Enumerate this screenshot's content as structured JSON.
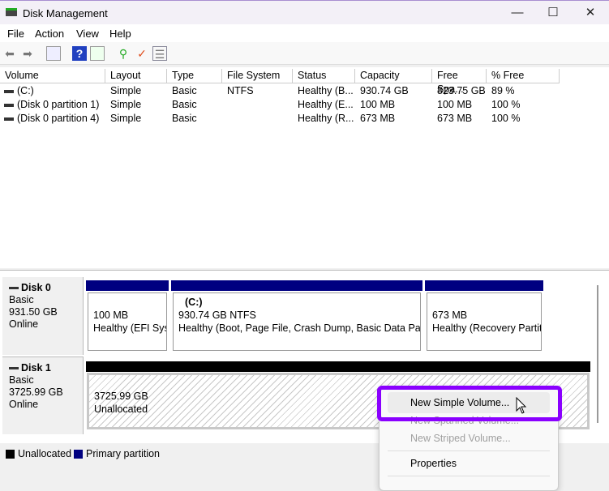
{
  "window": {
    "title": "Disk Management",
    "minimize": "—",
    "maximize": "☐",
    "close": "✕"
  },
  "menu": [
    "File",
    "Action",
    "View",
    "Help"
  ],
  "columns": [
    "Volume",
    "Layout",
    "Type",
    "File System",
    "Status",
    "Capacity",
    "Free Spa...",
    "% Free"
  ],
  "rows": [
    [
      "(C:)",
      "Simple",
      "Basic",
      "NTFS",
      "Healthy (B...",
      "930.74 GB",
      "823.75 GB",
      "89 %"
    ],
    [
      "(Disk 0 partition 1)",
      "Simple",
      "Basic",
      "",
      "Healthy (E...",
      "100 MB",
      "100 MB",
      "100 %"
    ],
    [
      "(Disk 0 partition 4)",
      "Simple",
      "Basic",
      "",
      "Healthy (R...",
      "673 MB",
      "673 MB",
      "100 %"
    ]
  ],
  "disks": [
    {
      "name": "Disk 0",
      "type": "Basic",
      "size": "931.50 GB",
      "status": "Online",
      "partitions": [
        {
          "label": "",
          "size": "100 MB",
          "status": "Healthy (EFI System Partition)"
        },
        {
          "label": "(C:)",
          "size": "930.74 GB NTFS",
          "status": "Healthy (Boot, Page File, Crash Dump, Basic Data Partition)"
        },
        {
          "label": "",
          "size": "673 MB",
          "status": "Healthy (Recovery Partition)"
        }
      ]
    },
    {
      "name": "Disk 1",
      "type": "Basic",
      "size": "3725.99 GB",
      "status": "Online",
      "partitions": [
        {
          "size": "3725.99 GB",
          "status": "Unallocated"
        }
      ]
    }
  ],
  "legend": {
    "unallocated": "Unallocated",
    "primary": "Primary partition",
    "colors": {
      "unallocated": "#000000",
      "primary": "#000080"
    }
  },
  "context_menu": [
    "New Simple Volume...",
    "New Spanned Volume...",
    "New Striped Volume...",
    "Properties"
  ]
}
